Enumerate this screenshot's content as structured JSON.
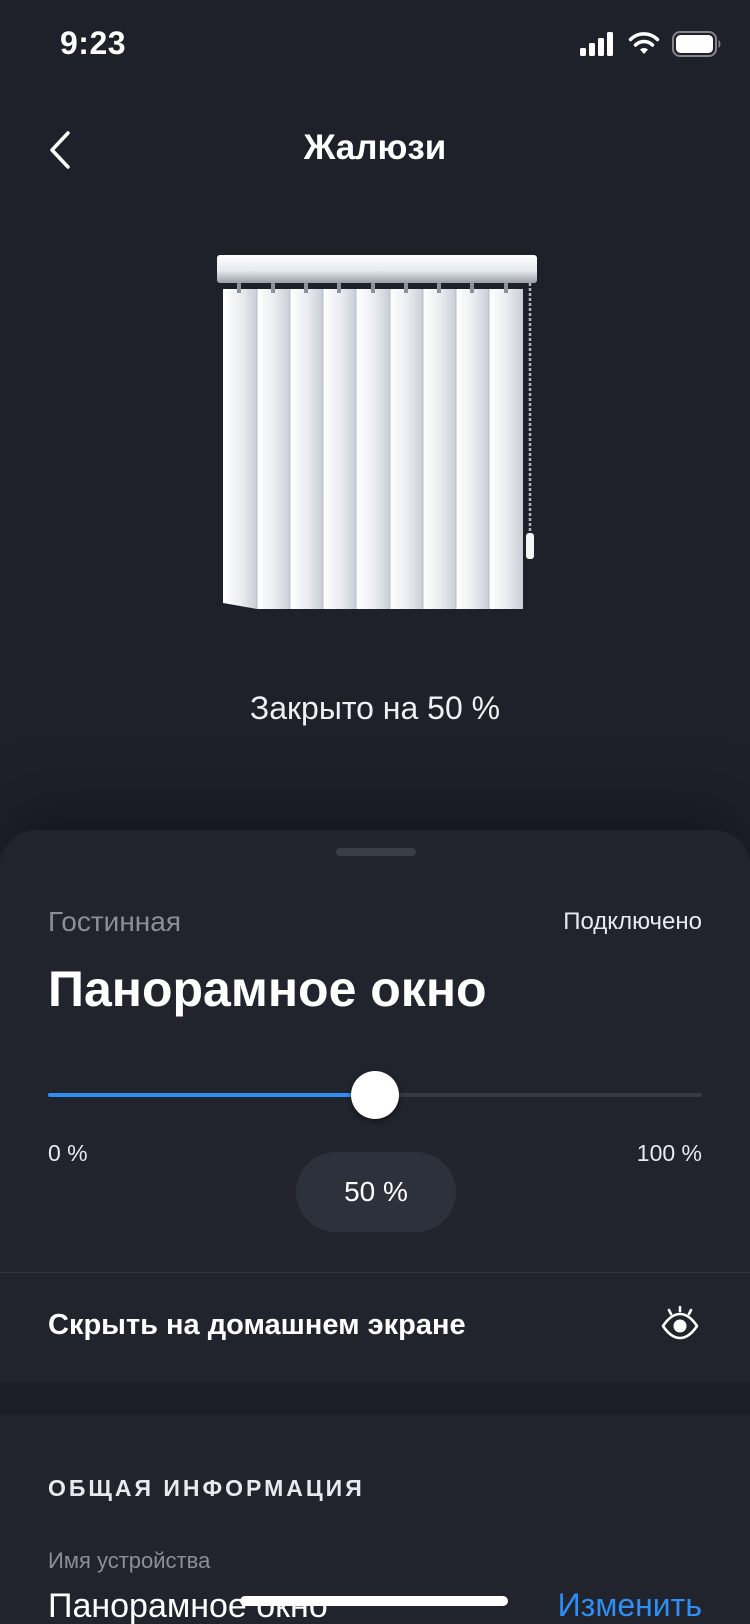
{
  "status_bar": {
    "time": "9:23",
    "icons": [
      "cellular-signal-icon",
      "wifi-icon",
      "battery-icon"
    ]
  },
  "header": {
    "title": "Жалюзи",
    "back_icon": "chevron-left-icon"
  },
  "illustration": {
    "name": "vertical-blinds-illustration"
  },
  "status": {
    "closed_text": "Закрыто на 50 %"
  },
  "device": {
    "room": "Гостинная",
    "connection": "Подключено",
    "name": "Панорамное окно"
  },
  "slider": {
    "value_fraction": 0.5,
    "min_label": "0 %",
    "max_label": "100 %",
    "value_label": "50 %",
    "accent_color": "#2f8ef4"
  },
  "hide_row": {
    "label": "Скрыть на домашнем экране",
    "icon": "eye-icon"
  },
  "info": {
    "section_title": "ОБЩАЯ ИНФОРМАЦИЯ",
    "device_name_label": "Имя устройства",
    "device_name_value": "Панорамное окно",
    "edit_label": "Изменить"
  },
  "colors": {
    "background": "#1e212a",
    "sheet": "#21242d",
    "accent": "#2f8ef4"
  }
}
